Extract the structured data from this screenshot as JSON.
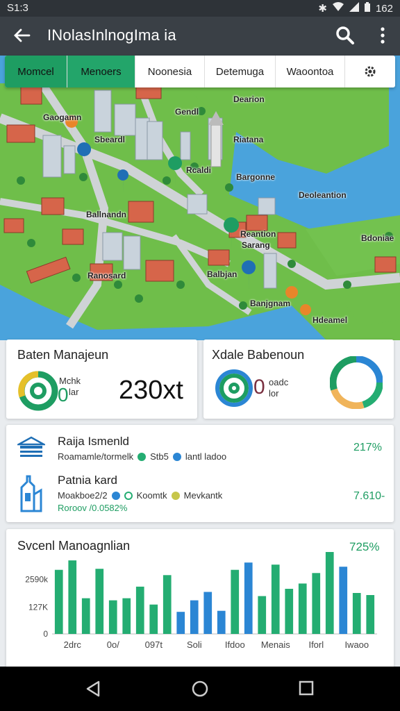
{
  "status_bar": {
    "time": "S1:3",
    "battery": "162"
  },
  "app_bar": {
    "title": "INolasInlnogIma ia"
  },
  "tabs": [
    {
      "label": "Momcel"
    },
    {
      "label": "Menoers"
    },
    {
      "label": "Noonesia"
    },
    {
      "label": "Detemuga"
    },
    {
      "label": "Waoontoa"
    }
  ],
  "map": {
    "labels": [
      "Gaogamn",
      "Gendl",
      "Sbeardl",
      "Dearion",
      "Riatana",
      "Bargonne",
      "Rcaldi",
      "Deoleantion",
      "Ballnandn",
      "Reantion",
      "Bdoniae",
      "Ranosard",
      "Balbjan",
      "Banjgnam",
      "Hdeamel",
      "Sarang"
    ]
  },
  "card_left": {
    "title": "Baten Manajeun",
    "donut_label_top": "Mchk",
    "donut_label_bottom": "lar",
    "donut_value": "0",
    "big_value": "230xt",
    "accent": "#1e9d62"
  },
  "card_right": {
    "title": "Xdale Babenoun",
    "donut_label_top": "oadc",
    "donut_label_bottom": "lor",
    "donut_value": "0"
  },
  "list_card": {
    "rows": [
      {
        "title": "Raija Ismenld",
        "legend": [
          "Roamamle/tormelk",
          "Stb5",
          "lantl ladoo"
        ],
        "value": "217%",
        "sub": ""
      },
      {
        "title": "Patnia kard",
        "legend": [
          "Moakboe2/2",
          "Koomtk",
          "Mevkantk"
        ],
        "value": "7.610-",
        "sub": "Roroov /0.0582%"
      }
    ]
  },
  "chart_card": {
    "title": "Svcenl Manoagnlian",
    "value": "725%"
  },
  "chart_data": {
    "type": "bar",
    "title": "Svcenl Manoagnlian",
    "xlabel": "",
    "ylabel": "",
    "ylim": [
      0,
      4000
    ],
    "yticks": [
      "0",
      "127K",
      "2590k"
    ],
    "xtick_labels": [
      "2drc",
      "0o/",
      "097t",
      "Soli",
      "Ifdoo",
      "Menais",
      "Iforl",
      "Iwaoo"
    ],
    "colors": {
      "green": "#24ad72",
      "blue": "#2b86d4"
    },
    "values": [
      3050,
      3500,
      1700,
      3100,
      1600,
      1700,
      2250,
      1400,
      2800,
      1050,
      1600,
      2000,
      1100,
      3050,
      3400,
      1800,
      3300,
      2150,
      2400,
      2900,
      3900,
      3200,
      1950,
      1850
    ],
    "bar_colors": [
      "green",
      "green",
      "green",
      "green",
      "green",
      "green",
      "green",
      "green",
      "green",
      "blue",
      "blue",
      "blue",
      "blue",
      "green",
      "blue",
      "green",
      "green",
      "green",
      "green",
      "green",
      "green",
      "blue",
      "green",
      "green"
    ]
  }
}
